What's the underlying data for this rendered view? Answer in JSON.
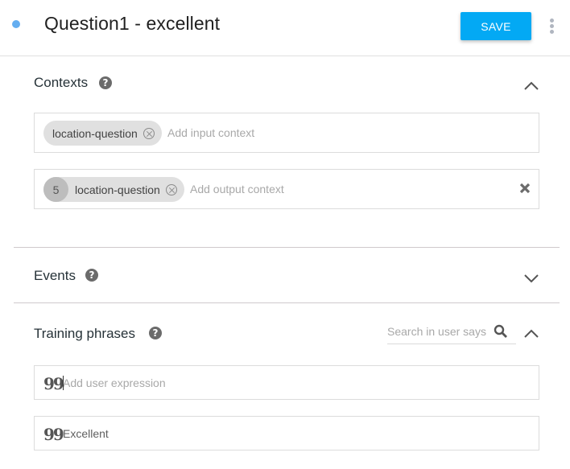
{
  "header": {
    "title": "Question1 - excellent",
    "save_label": "SAVE",
    "status_color": "#64aef0",
    "accent_color": "#03a9f4"
  },
  "contexts": {
    "title": "Contexts",
    "help_icon": "question-circle-icon",
    "expanded": true,
    "input": {
      "chips": [
        {
          "label": "location-question"
        }
      ],
      "placeholder": "Add input context"
    },
    "output": {
      "chips": [
        {
          "lifespan": "5",
          "label": "location-question"
        }
      ],
      "placeholder": "Add output context"
    }
  },
  "events": {
    "title": "Events",
    "help_icon": "question-circle-icon",
    "expanded": false
  },
  "training_phrases": {
    "title": "Training phrases",
    "help_icon": "question-circle-icon",
    "expanded": true,
    "search_placeholder": "Search in user says",
    "new_placeholder": "Add user expression",
    "quote_glyph": "99",
    "items": [
      {
        "text": "Excellent"
      }
    ]
  }
}
